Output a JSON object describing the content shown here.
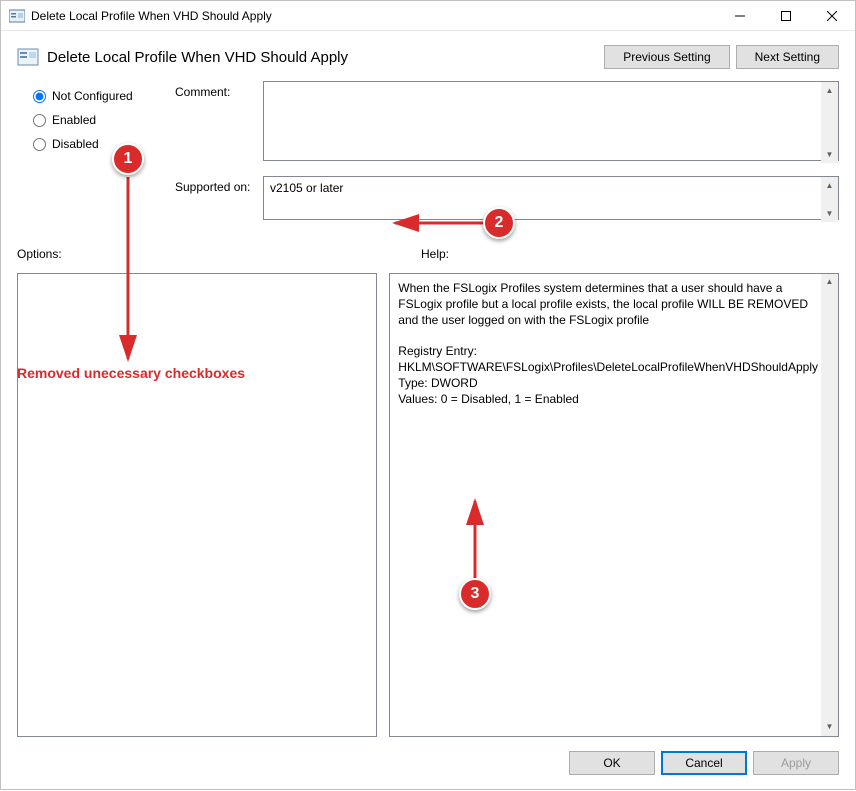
{
  "window": {
    "title": "Delete Local Profile When VHD Should Apply"
  },
  "header": {
    "title": "Delete Local Profile When VHD Should Apply",
    "prev": "Previous Setting",
    "next": "Next Setting"
  },
  "radios": {
    "not_configured": "Not Configured",
    "enabled": "Enabled",
    "disabled": "Disabled",
    "selected": "not_configured"
  },
  "fields": {
    "comment_label": "Comment:",
    "comment_value": "",
    "supported_label": "Supported on:",
    "supported_value": "v2105 or later"
  },
  "sections": {
    "options_label": "Options:",
    "help_label": "Help:"
  },
  "help": {
    "p1": "When the FSLogix Profiles system determines that a user should have a FSLogix profile but a local profile exists, the local profile WILL BE REMOVED and the user logged on with the FSLogix profile",
    "p2a": "Registry Entry:  HKLM\\SOFTWARE\\FSLogix\\Profiles\\DeleteLocalProfileWhenVHDShouldApply",
    "p2b": "Type:  DWORD",
    "p2c": "Values:  0 = Disabled, 1 = Enabled"
  },
  "footer": {
    "ok": "OK",
    "cancel": "Cancel",
    "apply": "Apply"
  },
  "annotations": {
    "badge1": "1",
    "badge2": "2",
    "badge3": "3",
    "removed_text": "Removed unecessary checkboxes"
  }
}
